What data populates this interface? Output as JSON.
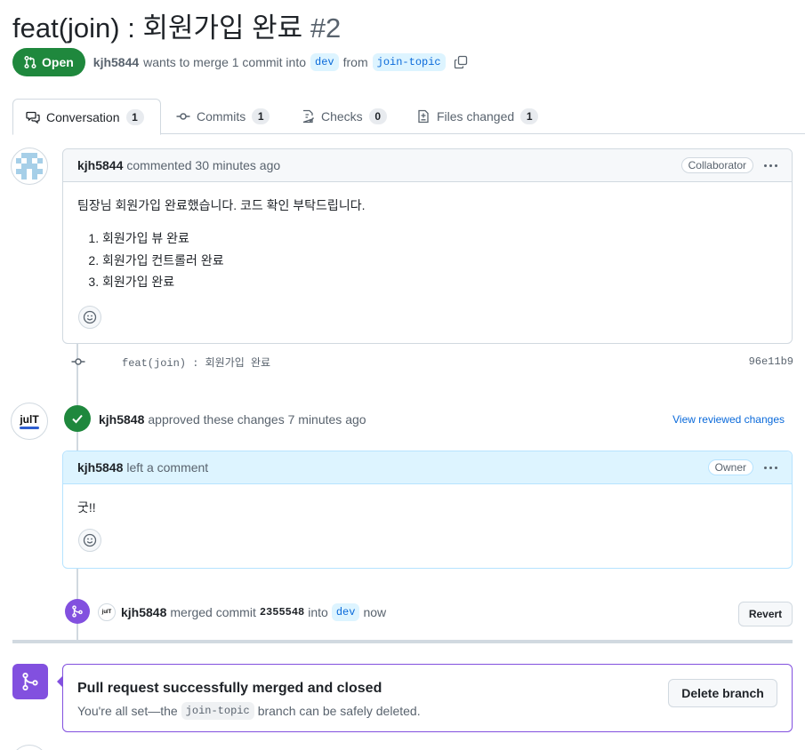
{
  "pr": {
    "title": "feat(join) : 회원가입 완료",
    "number": "#2",
    "state": "Open",
    "author": "kjh5844",
    "merge_text_1": "wants to merge 1 commit into",
    "base_branch": "dev",
    "from_text": "from",
    "head_branch": "join-topic"
  },
  "tabs": [
    {
      "label": "Conversation",
      "count": "1"
    },
    {
      "label": "Commits",
      "count": "1"
    },
    {
      "label": "Checks",
      "count": "0"
    },
    {
      "label": "Files changed",
      "count": "1"
    }
  ],
  "comment1": {
    "author": "kjh5844",
    "action": "commented 30 minutes ago",
    "role": "Collaborator",
    "text": "팀장님 회원가입 완료했습니다. 코드 확인 부탁드립니다.",
    "list": [
      "회원가입 뷰 완료",
      "회원가입 컨트롤러 완료",
      "회원가입 완료"
    ]
  },
  "commit": {
    "message": "feat(join) : 회원가입 완료",
    "sha": "96e11b9"
  },
  "review": {
    "author": "kjh5848",
    "action": "approved these changes 7 minutes ago",
    "link": "View reviewed changes",
    "avatar_text": "julT"
  },
  "comment2": {
    "author": "kjh5848",
    "action": "left a comment",
    "role": "Owner",
    "text": "굿!!"
  },
  "merge_event": {
    "author": "kjh5848",
    "text1": "merged commit",
    "sha": "2355548",
    "text2": "into",
    "branch": "dev",
    "text3": "now",
    "revert": "Revert"
  },
  "merged_box": {
    "title": "Pull request successfully merged and closed",
    "text1": "You're all set—the",
    "branch": "join-topic",
    "text2": "branch can be safely deleted.",
    "delete_button": "Delete branch"
  },
  "colors": {
    "open_green": "#1f883d",
    "merged_purple": "#8250df",
    "link_blue": "#0969da",
    "owner_blue_bg": "#ddf4ff"
  }
}
